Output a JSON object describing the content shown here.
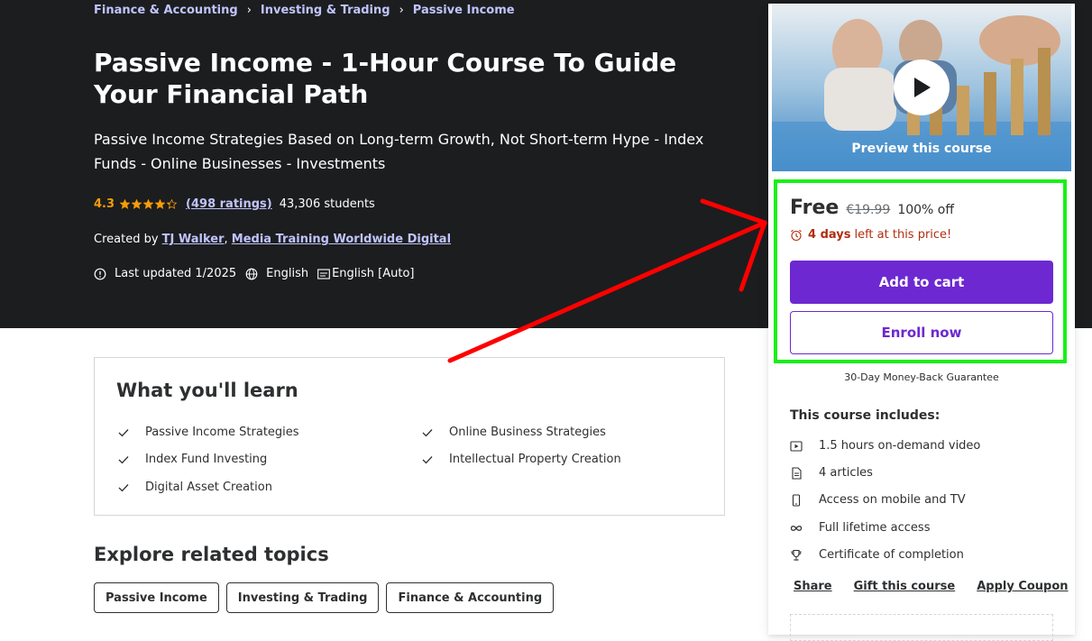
{
  "breadcrumb": [
    "Finance & Accounting",
    "Investing & Trading",
    "Passive Income"
  ],
  "course": {
    "title": "Passive Income - 1-Hour Course To Guide Your Financial Path",
    "subtitle": "Passive Income Strategies Based on Long-term Growth, Not Short-term Hype - Index Funds - Online Businesses - Investments",
    "rating": "4.3",
    "rating_value": 4.3,
    "ratings_count": "(498 ratings)",
    "students": "43,306 students",
    "created_by_label": "Created by",
    "authors": [
      "TJ Walker",
      "Media Training Worldwide Digital"
    ],
    "last_updated": "Last updated 1/2025",
    "language": "English",
    "captions": "English [Auto]"
  },
  "learn": {
    "title": "What you'll learn",
    "items": [
      "Passive Income Strategies",
      "Online Business Strategies",
      "Index Fund Investing",
      "Intellectual Property Creation",
      "Digital Asset Creation"
    ]
  },
  "explore": {
    "title": "Explore related topics",
    "tags": [
      "Passive Income",
      "Investing & Trading",
      "Finance & Accounting"
    ]
  },
  "sidebar": {
    "preview_label": "Preview this course",
    "price": "Free",
    "original_price": "€19.99",
    "discount": "100% off",
    "timer_bold": "4 days",
    "timer_rest": "left at this price!",
    "add_to_cart": "Add to cart",
    "enroll_now": "Enroll now",
    "guarantee": "30-Day Money-Back Guarantee",
    "includes_title": "This course includes:",
    "includes": [
      {
        "icon": "video-icon",
        "label": "1.5 hours on-demand video"
      },
      {
        "icon": "article-icon",
        "label": "4 articles"
      },
      {
        "icon": "mobile-icon",
        "label": "Access on mobile and TV"
      },
      {
        "icon": "infinity-icon",
        "label": "Full lifetime access"
      },
      {
        "icon": "trophy-icon",
        "label": "Certificate of completion"
      }
    ],
    "links": [
      "Share",
      "Gift this course",
      "Apply Coupon"
    ]
  },
  "colors": {
    "hero_bg": "#1c1d1f",
    "link_purple": "#c0c4fc",
    "star": "#f69c08",
    "primary": "#6d28d2",
    "timer_red": "#b32d0f",
    "highlight_green": "#18f018",
    "annotation_red": "#ff0000"
  }
}
